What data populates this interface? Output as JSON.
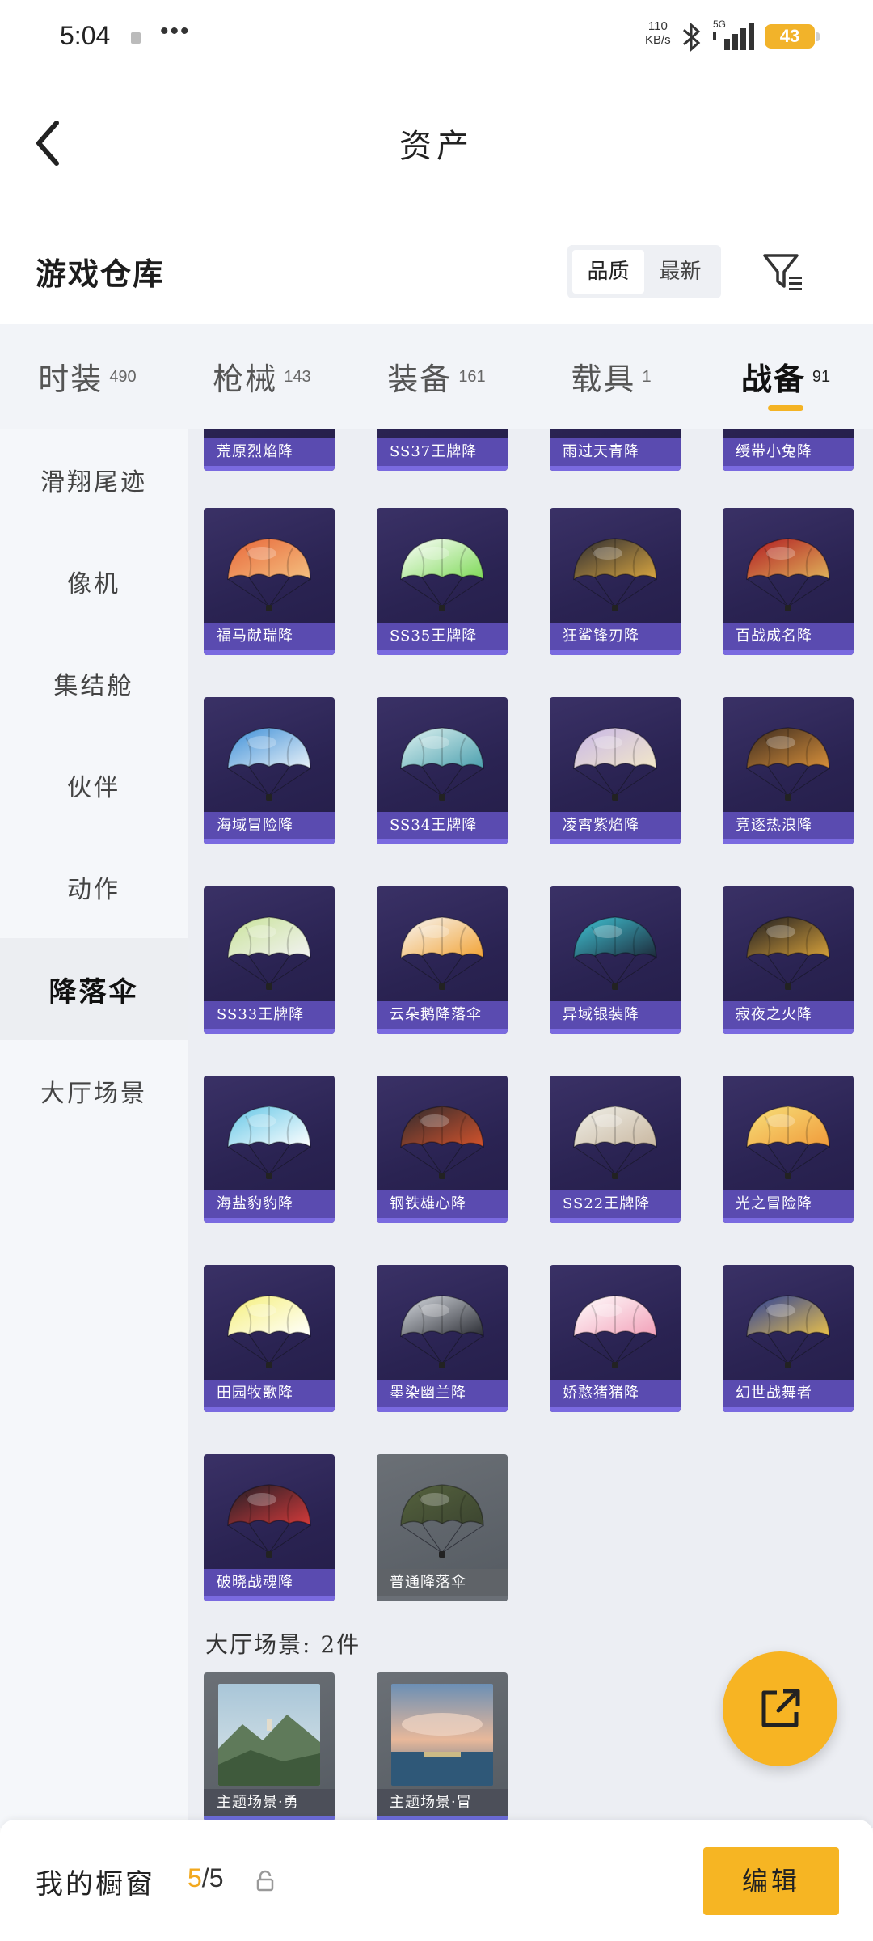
{
  "status_bar": {
    "time": "5:04",
    "more": "•••",
    "speed_value": "110",
    "speed_unit": "KB/s",
    "network": "5G",
    "battery": "43"
  },
  "header": {
    "title": "资产"
  },
  "warehouse": {
    "title": "游戏仓库",
    "sort_options": [
      "品质",
      "最新"
    ],
    "active_sort": "品质"
  },
  "categories": [
    {
      "label": "时装",
      "count": "490"
    },
    {
      "label": "枪械",
      "count": "143"
    },
    {
      "label": "装备",
      "count": "161"
    },
    {
      "label": "载具",
      "count": "1"
    },
    {
      "label": "战备",
      "count": "91",
      "active": true
    }
  ],
  "sidebar": {
    "items": [
      "滑翔尾迹",
      "像机",
      "集结舱",
      "伙伴",
      "动作",
      "降落伞",
      "大厅场景"
    ],
    "active": "降落伞"
  },
  "parachutes": {
    "top_partial": [
      "荒原烈焰降",
      "SS37王牌降",
      "雨过天青降",
      "绶带小兔降"
    ],
    "items": [
      {
        "name": "福马献瑞降",
        "colors": [
          "#e8673a",
          "#f4c080"
        ]
      },
      {
        "name": "SS35王牌降",
        "colors": [
          "#ffffff",
          "#7ed957"
        ]
      },
      {
        "name": "狂鲨锋刃降",
        "colors": [
          "#2b2b33",
          "#d9a640"
        ]
      },
      {
        "name": "百战成名降",
        "colors": [
          "#b01a22",
          "#e0b35a"
        ]
      },
      {
        "name": "海域冒险降",
        "colors": [
          "#3d8fd8",
          "#e9f1f7"
        ]
      },
      {
        "name": "SS34王牌降",
        "colors": [
          "#dff3f1",
          "#4b9fae"
        ]
      },
      {
        "name": "凌霄紫焰降",
        "colors": [
          "#c8b7e8",
          "#f2e7c8"
        ]
      },
      {
        "name": "竞逐热浪降",
        "colors": [
          "#3a2a20",
          "#d8903a"
        ]
      },
      {
        "name": "SS33王牌降",
        "colors": [
          "#c9e39a",
          "#f2f2f2"
        ]
      },
      {
        "name": "云朵鹅降落伞",
        "colors": [
          "#f7f7f7",
          "#f2a335"
        ]
      },
      {
        "name": "异域银装降",
        "colors": [
          "#40c5d6",
          "#1d2a3a"
        ]
      },
      {
        "name": "寂夜之火降",
        "colors": [
          "#1b1b22",
          "#d7a13a"
        ]
      },
      {
        "name": "海盐豹豹降",
        "colors": [
          "#64c6e6",
          "#ffffff"
        ]
      },
      {
        "name": "钢铁雄心降",
        "colors": [
          "#2c2a2e",
          "#d4532c"
        ]
      },
      {
        "name": "SS22王牌降",
        "colors": [
          "#efefe8",
          "#c9b7a0"
        ]
      },
      {
        "name": "光之冒险降",
        "colors": [
          "#f7e07a",
          "#f09a3a"
        ]
      },
      {
        "name": "田园牧歌降",
        "colors": [
          "#f5ef7a",
          "#ffffff"
        ]
      },
      {
        "name": "墨染幽兰降",
        "colors": [
          "#d9dde3",
          "#2a2c33"
        ]
      },
      {
        "name": "娇憨猪猪降",
        "colors": [
          "#ffffff",
          "#f2a0b8"
        ]
      },
      {
        "name": "幻世战舞者",
        "colors": [
          "#2a3f9a",
          "#e9c04a"
        ]
      },
      {
        "name": "破晓战魂降",
        "colors": [
          "#1e1e26",
          "#d43a3a"
        ]
      },
      {
        "name": "普通降落伞",
        "colors": [
          "#55623e",
          "#3c4530"
        ],
        "gray": true
      }
    ]
  },
  "lobby_scenes": {
    "label": "大厅场景: 2件",
    "items": [
      "主题场景·勇",
      "主题场景·冒"
    ]
  },
  "showcase": {
    "label": "我的橱窗",
    "current": "5",
    "total": "/5",
    "edit_label": "编辑"
  },
  "accent_color": "#f6b523",
  "tile_color": "#2a2352"
}
